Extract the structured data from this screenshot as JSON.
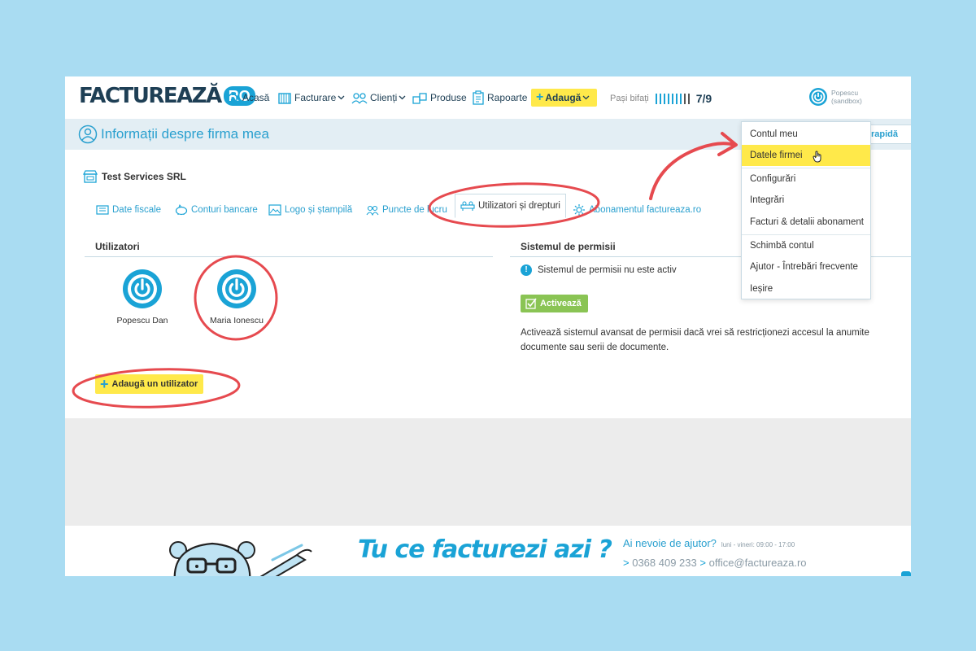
{
  "brand": {
    "logo_word": "FACTUREAZĂ",
    "logo_ro": "RO",
    "primary": "#1aa3d6",
    "dark": "#1e3f55",
    "highlight": "#ffe94a",
    "success": "#8ac454"
  },
  "nav": {
    "home": "Acasă",
    "invoicing": "Facturare",
    "clients": "Clienți",
    "products": "Produse",
    "reports": "Rapoarte",
    "add": "Adaugă"
  },
  "steps": {
    "label": "Pași bifați",
    "completed": 7,
    "total": 9,
    "count_text": "7/9"
  },
  "user": {
    "name": "Popescu",
    "mode": "(sandbox)"
  },
  "page": {
    "title": "Informații despre firma mea",
    "quick_search": "rapidă"
  },
  "company": {
    "name": "Test Services SRL"
  },
  "tabs": [
    {
      "label": "Date fiscale",
      "icon": "id-card-icon"
    },
    {
      "label": "Conturi bancare",
      "icon": "piggy-bank-icon"
    },
    {
      "label": "Logo și ștampilă",
      "icon": "image-icon"
    },
    {
      "label": "Puncte de lucru",
      "icon": "people-icon"
    },
    {
      "label": "Utilizatori și drepturi",
      "icon": "users-icon",
      "active": true
    },
    {
      "label": "Abonamentul factureaza.ro",
      "icon": "gear-icon"
    }
  ],
  "users_section": {
    "title": "Utilizatori",
    "users": [
      {
        "name": "Popescu Dan"
      },
      {
        "name": "Maria Ionescu"
      }
    ],
    "add_button": "Adaugă un utilizator"
  },
  "permissions": {
    "title": "Sistemul de permisii",
    "status": "Sistemul de permisii nu este activ",
    "activate_button": "Activează",
    "description": "Activează sistemul avansat de permisii dacă vrei să restricționezi accesul la anumite documente sau serii de documente."
  },
  "account_menu": {
    "items": [
      "Contul meu",
      "Datele firmei",
      "Configurări",
      "Integrări",
      "Facturi & detalii abonament",
      "Schimbă contul",
      "Ajutor - Întrebări frecvente",
      "Ieșire"
    ],
    "highlighted": "Datele firmei"
  },
  "footer": {
    "slogan": "Tu ce facturezi azi ?",
    "help_title": "Ai nevoie de ajutor?",
    "hours": "luni - vineri: 09:00 - 17:00",
    "phone": "0368 409 233",
    "email": "office@factureaza.ro"
  }
}
